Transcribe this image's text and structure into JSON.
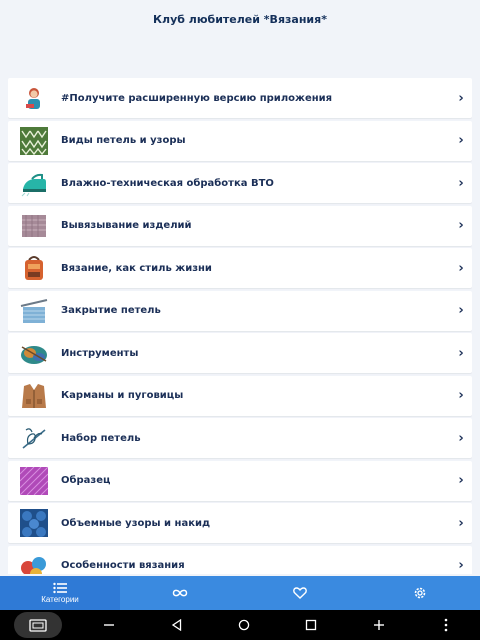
{
  "header": {
    "title": "Клуб любителей *Вязания*"
  },
  "categories": [
    {
      "label": "#Получите расширенную версию приложения",
      "icon": "knitter-avatar-icon"
    },
    {
      "label": "Виды петель и узоры",
      "icon": "stitch-pattern-icon"
    },
    {
      "label": "Влажно-техническая обработка ВТО",
      "icon": "steam-iron-icon"
    },
    {
      "label": "Вывязывание изделий",
      "icon": "knit-garment-icon"
    },
    {
      "label": "Вязание, как стиль жизни",
      "icon": "knitted-bag-icon"
    },
    {
      "label": "Закрытие петель",
      "icon": "bind-off-icon"
    },
    {
      "label": "Инструменты",
      "icon": "yarn-tools-icon"
    },
    {
      "label": "Карманы и пуговицы",
      "icon": "cardigan-icon"
    },
    {
      "label": "Набор петель",
      "icon": "cast-on-icon"
    },
    {
      "label": "Образец",
      "icon": "swatch-icon"
    },
    {
      "label": "Объемные узоры и накид",
      "icon": "textured-pattern-icon"
    },
    {
      "label": "Особенности вязания",
      "icon": "yarn-balls-icon"
    }
  ],
  "tabbar": {
    "tabs": [
      {
        "label": "Категории",
        "icon": "list-icon",
        "active": true
      },
      {
        "label": "",
        "icon": "infinity-icon"
      },
      {
        "label": "",
        "icon": "heart-icon"
      },
      {
        "label": "",
        "icon": "settings-icon"
      }
    ]
  },
  "colors": {
    "accent": "#3a8ae0",
    "text": "#1b2f57",
    "background": "#f1f4f9"
  }
}
